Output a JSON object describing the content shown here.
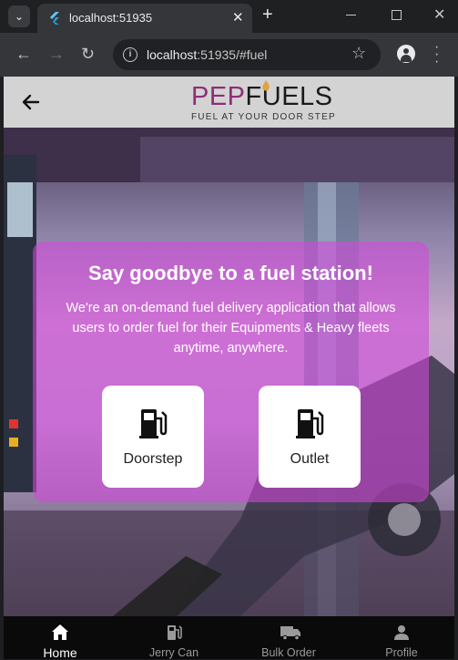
{
  "browser": {
    "tab_title": "localhost:51935",
    "url_host": "localhost",
    "url_rest": ":51935/#fuel"
  },
  "header": {
    "logo_pep": "PEP",
    "logo_fuels": "FUELS",
    "tagline": "FUEL AT YOUR DOOR STEP"
  },
  "hero": {
    "title": "Say goodbye to a fuel station!",
    "description": "We're an on-demand fuel delivery application that allows users to order fuel for their  Equipments & Heavy fleets  anytime, anywhere.",
    "options": [
      {
        "label": "Doorstep",
        "icon": "fuel-pump-icon"
      },
      {
        "label": "Outlet",
        "icon": "fuel-pump-icon"
      }
    ]
  },
  "nav": {
    "items": [
      {
        "label": "Home",
        "icon": "home-icon",
        "active": true
      },
      {
        "label": "Jerry Can",
        "icon": "fuel-can-icon",
        "active": false
      },
      {
        "label": "Bulk Order",
        "icon": "truck-icon",
        "active": false
      },
      {
        "label": "Profile",
        "icon": "person-icon",
        "active": false
      }
    ]
  },
  "colors": {
    "card_overlay": "#d446dc",
    "brand_purple": "#8e2d78",
    "appbar": "#d3d3d3",
    "nav_bg": "#0a0a0a"
  }
}
